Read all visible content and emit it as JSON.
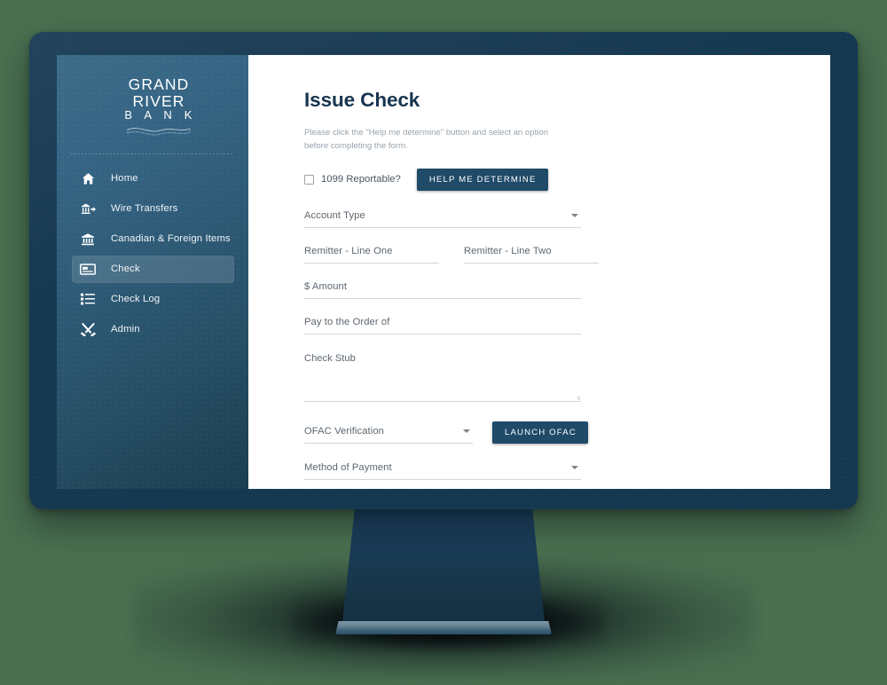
{
  "app": {
    "background_color": "#4a7050",
    "bezel_color": "#153851",
    "accent_color": "#1f4a68",
    "sidebar_gradient_from": "#3d6c88",
    "sidebar_gradient_to": "#1b3e51"
  },
  "sidebar": {
    "logo": {
      "line1": "GRAND",
      "line2": "RIVER",
      "line3": "B A N K"
    },
    "items": [
      {
        "label": "Home",
        "icon": "home-icon",
        "active": false
      },
      {
        "label": "Wire Transfers",
        "icon": "wire-transfer-icon",
        "active": false
      },
      {
        "label": "Canadian & Foreign Items",
        "icon": "bank-icon",
        "active": false
      },
      {
        "label": "Check",
        "icon": "check-icon",
        "active": true
      },
      {
        "label": "Check Log",
        "icon": "list-icon",
        "active": false
      },
      {
        "label": "Admin",
        "icon": "tools-icon",
        "active": false
      }
    ]
  },
  "main": {
    "title": "Issue Check",
    "description": "Please click the \"Help me determine\" button and select an option before completing the form.",
    "reportable": {
      "label": "1099 Reportable?",
      "checked": false
    },
    "help_button": "HELP ME DETERMINE",
    "fields": {
      "account_type": {
        "label": "Account Type",
        "value": ""
      },
      "remitter_line_one": {
        "label": "Remitter - Line One",
        "value": ""
      },
      "remitter_line_two": {
        "label": "Remitter - Line Two",
        "value": ""
      },
      "amount": {
        "label": "$ Amount",
        "value": ""
      },
      "pay_to_order_of": {
        "label": "Pay to the Order of",
        "value": ""
      },
      "check_stub": {
        "label": "Check Stub",
        "value": ""
      },
      "ofac_verification": {
        "label": "OFAC Verification",
        "value": ""
      },
      "method_of_payment": {
        "label": "Method of Payment",
        "value": ""
      }
    },
    "ofac_button": "LAUNCH OFAC"
  }
}
